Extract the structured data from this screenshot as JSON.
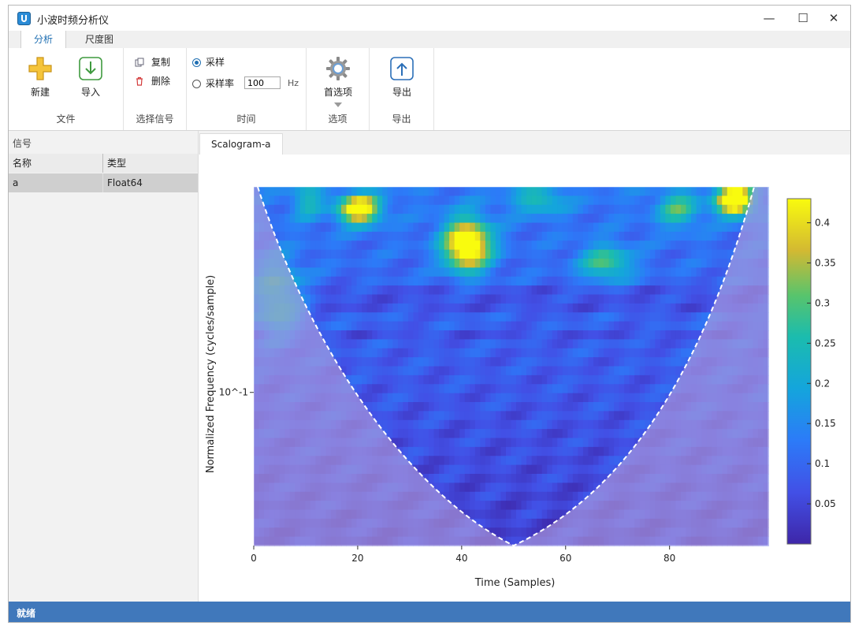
{
  "window": {
    "title": "小波时频分析仪",
    "controls": {
      "minimize": "—",
      "maximize": "☐",
      "close": "✕"
    }
  },
  "ribbon_tabs": [
    {
      "label": "分析",
      "active": true
    },
    {
      "label": "尺度图",
      "active": false
    }
  ],
  "ribbon": {
    "file_group": {
      "label": "文件",
      "new_label": "新建",
      "import_label": "导入"
    },
    "signal_group": {
      "label": "选择信号",
      "copy_label": "复制",
      "delete_label": "删除"
    },
    "time_group": {
      "label": "时间",
      "samples_label": "采样",
      "rate_label": "采样率",
      "rate_value": "100",
      "rate_unit": "Hz",
      "selected": "samples"
    },
    "options_group": {
      "label": "选项",
      "prefs_label": "首选项"
    },
    "export_group": {
      "label": "导出",
      "export_label": "导出"
    }
  },
  "signals_panel": {
    "title": "信号",
    "columns": [
      "名称",
      "类型"
    ],
    "rows": [
      {
        "name": "a",
        "type": "Float64",
        "selected": true
      }
    ]
  },
  "document_tabs": [
    {
      "label": "Scalogram-a",
      "active": true
    }
  ],
  "chart_data": {
    "type": "heatmap",
    "xlabel": "Time (Samples)",
    "ylabel": "Normalized Frequency  (cycles/sample)",
    "xlim": [
      0,
      99
    ],
    "x_ticks": [
      0,
      20,
      40,
      60,
      80
    ],
    "y_scale": "log",
    "y_tick_labels": [
      "10^-1"
    ],
    "colorbar": {
      "ticks": [
        0.05,
        0.1,
        0.15,
        0.2,
        0.25,
        0.3,
        0.35,
        0.4
      ],
      "range": [
        0,
        0.43
      ],
      "colormap": "parula"
    },
    "cone_of_influence": {
      "style": "dashed",
      "color": "#ffffff",
      "minimum_at_sample": 50
    }
  },
  "status": {
    "text": "就绪"
  },
  "colors": {
    "accent": "#1f6fb2",
    "status_bar": "#4078bb",
    "cone_shade": "#b4a0dc"
  }
}
